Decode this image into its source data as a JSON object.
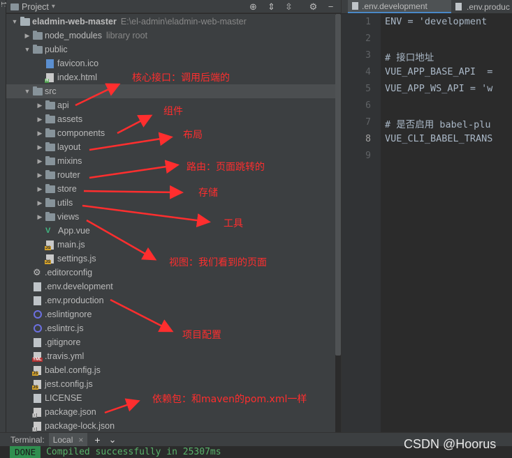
{
  "stripe": {
    "label": "1: Project"
  },
  "panel": {
    "title": "Project",
    "title_arrow": "▾"
  },
  "tree": [
    {
      "depth": 0,
      "arrow": "down",
      "type": "folder-root",
      "label": "eladmin-web-master",
      "extra": "E:\\el-admin\\eladmin-web-master",
      "bold": true
    },
    {
      "depth": 1,
      "arrow": "right",
      "type": "folder",
      "label": "node_modules",
      "extra": "library root"
    },
    {
      "depth": 1,
      "arrow": "down",
      "type": "folder",
      "label": "public"
    },
    {
      "depth": 2,
      "arrow": "none",
      "type": "ico",
      "label": "favicon.ico"
    },
    {
      "depth": 2,
      "arrow": "none",
      "type": "html",
      "label": "index.html"
    },
    {
      "depth": 1,
      "arrow": "down",
      "type": "folder",
      "label": "src",
      "selected": true
    },
    {
      "depth": 2,
      "arrow": "right",
      "type": "folder",
      "label": "api"
    },
    {
      "depth": 2,
      "arrow": "right",
      "type": "folder",
      "label": "assets"
    },
    {
      "depth": 2,
      "arrow": "right",
      "type": "folder",
      "label": "components"
    },
    {
      "depth": 2,
      "arrow": "right",
      "type": "folder",
      "label": "layout"
    },
    {
      "depth": 2,
      "arrow": "right",
      "type": "folder",
      "label": "mixins"
    },
    {
      "depth": 2,
      "arrow": "right",
      "type": "folder",
      "label": "router"
    },
    {
      "depth": 2,
      "arrow": "right",
      "type": "folder",
      "label": "store"
    },
    {
      "depth": 2,
      "arrow": "right",
      "type": "folder",
      "label": "utils"
    },
    {
      "depth": 2,
      "arrow": "right",
      "type": "folder",
      "label": "views"
    },
    {
      "depth": 2,
      "arrow": "none",
      "type": "vue",
      "label": "App.vue"
    },
    {
      "depth": 2,
      "arrow": "none",
      "type": "js",
      "label": "main.js"
    },
    {
      "depth": 2,
      "arrow": "none",
      "type": "js",
      "label": "settings.js"
    },
    {
      "depth": 1,
      "arrow": "none",
      "type": "gear",
      "label": ".editorconfig"
    },
    {
      "depth": 1,
      "arrow": "none",
      "type": "text",
      "label": ".env.development"
    },
    {
      "depth": 1,
      "arrow": "none",
      "type": "text",
      "label": ".env.production"
    },
    {
      "depth": 1,
      "arrow": "none",
      "type": "circle",
      "label": ".eslintignore"
    },
    {
      "depth": 1,
      "arrow": "none",
      "type": "circle",
      "label": ".eslintrc.js"
    },
    {
      "depth": 1,
      "arrow": "none",
      "type": "text",
      "label": ".gitignore"
    },
    {
      "depth": 1,
      "arrow": "none",
      "type": "yml",
      "label": ".travis.yml"
    },
    {
      "depth": 1,
      "arrow": "none",
      "type": "js",
      "label": "babel.config.js"
    },
    {
      "depth": 1,
      "arrow": "none",
      "type": "js",
      "label": "jest.config.js"
    },
    {
      "depth": 1,
      "arrow": "none",
      "type": "text",
      "label": "LICENSE"
    },
    {
      "depth": 1,
      "arrow": "none",
      "type": "json",
      "label": "package.json"
    },
    {
      "depth": 1,
      "arrow": "none",
      "type": "json",
      "label": "package-lock.json"
    }
  ],
  "annotations": [
    {
      "id": "ann-core-api",
      "text": "核心接口：调用后端的"
    },
    {
      "id": "ann-components",
      "text": "组件"
    },
    {
      "id": "ann-layout",
      "text": "布局"
    },
    {
      "id": "ann-router",
      "text": "路由：页面跳转的"
    },
    {
      "id": "ann-store",
      "text": "存储"
    },
    {
      "id": "ann-utils",
      "text": "工具"
    },
    {
      "id": "ann-views",
      "text": "视图：我们看到的页面"
    },
    {
      "id": "ann-config",
      "text": "项目配置"
    },
    {
      "id": "ann-deps",
      "text": "依赖包：和maven的pom.xml一样"
    }
  ],
  "annotation_color": "#ff2e2e",
  "editor": {
    "tabs": [
      {
        "label": ".env.development",
        "active": true
      },
      {
        "label": ".env.produc",
        "active": false
      }
    ],
    "lines": [
      {
        "n": "1",
        "text": "ENV = 'development"
      },
      {
        "n": "2",
        "text": ""
      },
      {
        "n": "3",
        "text": "# 接口地址"
      },
      {
        "n": "4",
        "text": "VUE_APP_BASE_API  ="
      },
      {
        "n": "5",
        "text": "VUE_APP_WS_API = 'w"
      },
      {
        "n": "6",
        "text": ""
      },
      {
        "n": "7",
        "text": "# 是否启用 babel-plu"
      },
      {
        "n": "8",
        "text": "VUE_CLI_BABEL_TRANS"
      },
      {
        "n": "9",
        "text": ""
      }
    ],
    "current_line": "8"
  },
  "terminal": {
    "label": "Terminal:",
    "tab": "Local",
    "close": "×",
    "add": "+",
    "dropdown": "⌄"
  },
  "status": {
    "badge": "DONE",
    "message": "Compiled successfully in 25307ms"
  },
  "watermark": "CSDN @Hoorus",
  "colors": {
    "accent": "#4a88c7",
    "done": "#2f8f4f",
    "compiled": "#59b36a",
    "panel_bg": "#3c3f41",
    "editor_bg": "#2b2b2b"
  }
}
